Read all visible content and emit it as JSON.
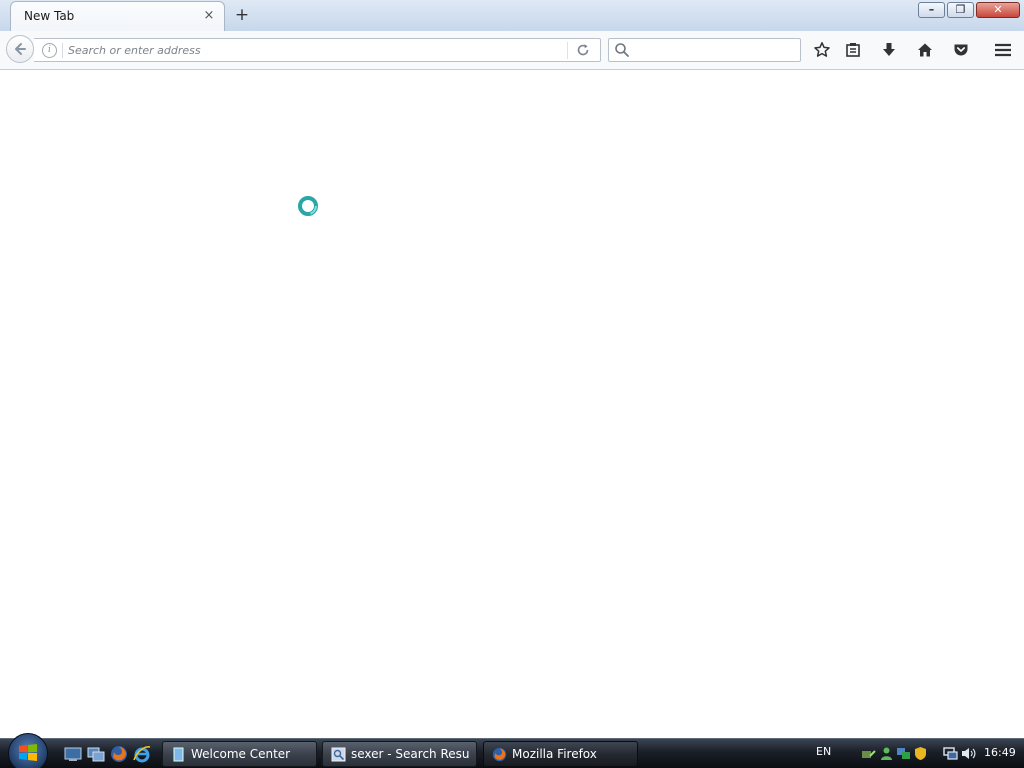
{
  "browser": {
    "tabs": [
      {
        "title": "New Tab"
      }
    ],
    "new_tab_label": "+",
    "close_tab_glyph": "×",
    "window_controls": {
      "minimize": "–",
      "maximize": "❐",
      "close": "✕"
    },
    "urlbar": {
      "value": "",
      "placeholder": "Search or enter address"
    },
    "searchbar": {
      "value": "",
      "placeholder": ""
    },
    "toolbar_icons": [
      "bookmark-star-icon",
      "reading-list-icon",
      "download-icon",
      "home-icon",
      "pocket-icon",
      "menu-icon"
    ],
    "page_state": "loading"
  },
  "taskbar": {
    "quick_launch": [
      "show-desktop-icon",
      "switch-windows-icon",
      "firefox-icon",
      "internet-explorer-icon"
    ],
    "buttons": [
      {
        "label": "Welcome Center",
        "icon": "welcome-center-icon",
        "active": false
      },
      {
        "label": "sexer - Search Resul...",
        "icon": "search-results-icon",
        "active": false
      },
      {
        "label": "Mozilla Firefox",
        "icon": "firefox-icon",
        "active": true
      }
    ],
    "language": "EN",
    "tray_icons": [
      "network-share-icon",
      "messenger-icon",
      "network-icon",
      "security-icon",
      "display-icon",
      "volume-icon"
    ],
    "clock": "16:49"
  },
  "colors": {
    "titlebar": "#c7d7ec",
    "toolbar": "#f8f9fa",
    "spinner": "#2aa6a6",
    "taskbar": "#1a1f27"
  }
}
